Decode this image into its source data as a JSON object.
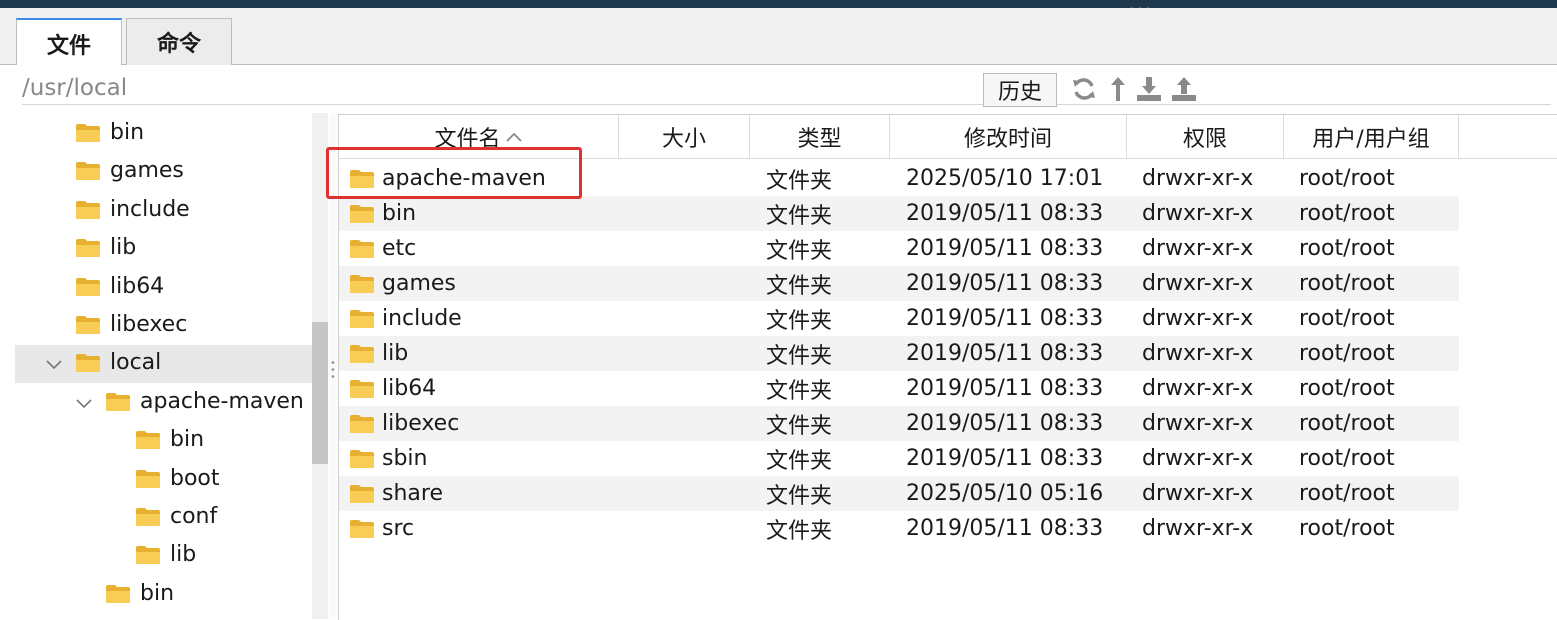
{
  "tabs": [
    {
      "label": "文件",
      "active": true
    },
    {
      "label": "命令",
      "active": false
    }
  ],
  "path": {
    "value": "/usr/local"
  },
  "toolbar": {
    "history_label": "历史",
    "icons": [
      "refresh-icon",
      "up-icon",
      "download-icon",
      "upload-icon"
    ]
  },
  "tree": {
    "items": [
      {
        "label": "bin",
        "depth": 0,
        "expanded": null,
        "selected": false
      },
      {
        "label": "games",
        "depth": 0,
        "expanded": null,
        "selected": false
      },
      {
        "label": "include",
        "depth": 0,
        "expanded": null,
        "selected": false
      },
      {
        "label": "lib",
        "depth": 0,
        "expanded": null,
        "selected": false
      },
      {
        "label": "lib64",
        "depth": 0,
        "expanded": null,
        "selected": false
      },
      {
        "label": "libexec",
        "depth": 0,
        "expanded": null,
        "selected": false
      },
      {
        "label": "local",
        "depth": 0,
        "expanded": true,
        "selected": true
      },
      {
        "label": "apache-maven",
        "depth": 1,
        "expanded": true,
        "selected": false
      },
      {
        "label": "bin",
        "depth": 2,
        "expanded": null,
        "selected": false
      },
      {
        "label": "boot",
        "depth": 2,
        "expanded": null,
        "selected": false
      },
      {
        "label": "conf",
        "depth": 2,
        "expanded": null,
        "selected": false
      },
      {
        "label": "lib",
        "depth": 2,
        "expanded": null,
        "selected": false
      },
      {
        "label": "bin",
        "depth": 1,
        "expanded": null,
        "selected": false
      }
    ]
  },
  "table": {
    "columns": [
      "文件名",
      "大小",
      "类型",
      "修改时间",
      "权限",
      "用户/用户组"
    ],
    "sort_indicator": "^",
    "rows": [
      {
        "name": "apache-maven",
        "size": "",
        "type": "文件夹",
        "modified": "2025/05/10 17:01",
        "perm": "drwxr-xr-x",
        "owner": "root/root"
      },
      {
        "name": "bin",
        "size": "",
        "type": "文件夹",
        "modified": "2019/05/11 08:33",
        "perm": "drwxr-xr-x",
        "owner": "root/root"
      },
      {
        "name": "etc",
        "size": "",
        "type": "文件夹",
        "modified": "2019/05/11 08:33",
        "perm": "drwxr-xr-x",
        "owner": "root/root"
      },
      {
        "name": "games",
        "size": "",
        "type": "文件夹",
        "modified": "2019/05/11 08:33",
        "perm": "drwxr-xr-x",
        "owner": "root/root"
      },
      {
        "name": "include",
        "size": "",
        "type": "文件夹",
        "modified": "2019/05/11 08:33",
        "perm": "drwxr-xr-x",
        "owner": "root/root"
      },
      {
        "name": "lib",
        "size": "",
        "type": "文件夹",
        "modified": "2019/05/11 08:33",
        "perm": "drwxr-xr-x",
        "owner": "root/root"
      },
      {
        "name": "lib64",
        "size": "",
        "type": "文件夹",
        "modified": "2019/05/11 08:33",
        "perm": "drwxr-xr-x",
        "owner": "root/root"
      },
      {
        "name": "libexec",
        "size": "",
        "type": "文件夹",
        "modified": "2019/05/11 08:33",
        "perm": "drwxr-xr-x",
        "owner": "root/root"
      },
      {
        "name": "sbin",
        "size": "",
        "type": "文件夹",
        "modified": "2019/05/11 08:33",
        "perm": "drwxr-xr-x",
        "owner": "root/root"
      },
      {
        "name": "share",
        "size": "",
        "type": "文件夹",
        "modified": "2025/05/10 05:16",
        "perm": "drwxr-xr-x",
        "owner": "root/root"
      },
      {
        "name": "src",
        "size": "",
        "type": "文件夹",
        "modified": "2019/05/11 08:33",
        "perm": "drwxr-xr-x",
        "owner": "root/root"
      }
    ]
  },
  "colors": {
    "highlight": "#e03131",
    "tab_accent": "#3c8be6",
    "folder": "#f4c542",
    "row_alt": "#f3f3f3",
    "dark_bar": "#1f3a4f"
  }
}
